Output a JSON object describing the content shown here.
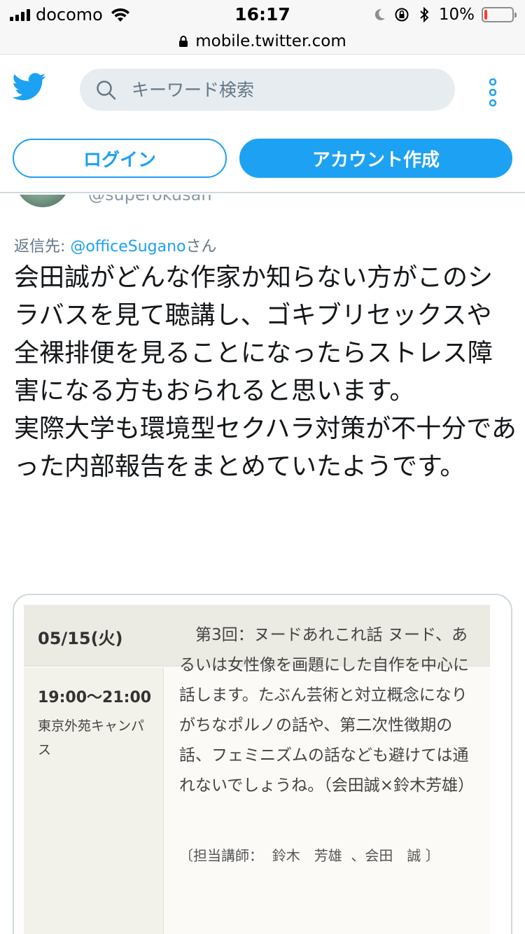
{
  "status": {
    "carrier": "docomo",
    "time": "16:17",
    "battery_pct": "10%",
    "battery_level": 0.1,
    "icons": [
      "signal-icon",
      "wifi-icon",
      "moon-icon",
      "rotation-lock-icon",
      "bluetooth-icon",
      "battery-icon"
    ]
  },
  "browser": {
    "url": "mobile.twitter.com"
  },
  "header": {
    "logo_icon": "twitter-bird-icon",
    "search_placeholder": "キーワード検索",
    "more_icon": "vertical-dots-icon"
  },
  "auth": {
    "login_label": "ログイン",
    "signup_label": "アカウント作成"
  },
  "tweet": {
    "handle": "@superokusan",
    "reply_prefix": "返信先: ",
    "reply_to": "@officeSugano",
    "reply_suffix": "さん",
    "text": "会田誠がどんな作家か知らない方がこのシラバスを見て聴講し、ゴキブリセックスや全裸排便を見ることになったらストレス障害になる方もおられると思います。\n実際大学も環境型セクハラ対策が不十分であった内部報告をまとめていたようです。"
  },
  "card": {
    "date": "05/15(火)",
    "time_slot": "19:00〜21:00",
    "venue": "東京外苑キャンパス",
    "description": "　第3回：ヌードあれこれ話 ヌード、あるいは女性像を画題にした自作を中心に話します。たぶん芸術と対立概念になりがちなポルノの話や、第二次性徴期の話、フェミニズムの話なども避けては通れないでしょうね。（会田誠×鈴木芳雄）",
    "lecturers": "〔担当講師：  鈴木　芳雄  、会田　誠 〕"
  },
  "colors": {
    "twitter_blue": "#1da1f2",
    "text": "#14171a",
    "muted": "#657786",
    "battery_low": "#ff3b30"
  }
}
